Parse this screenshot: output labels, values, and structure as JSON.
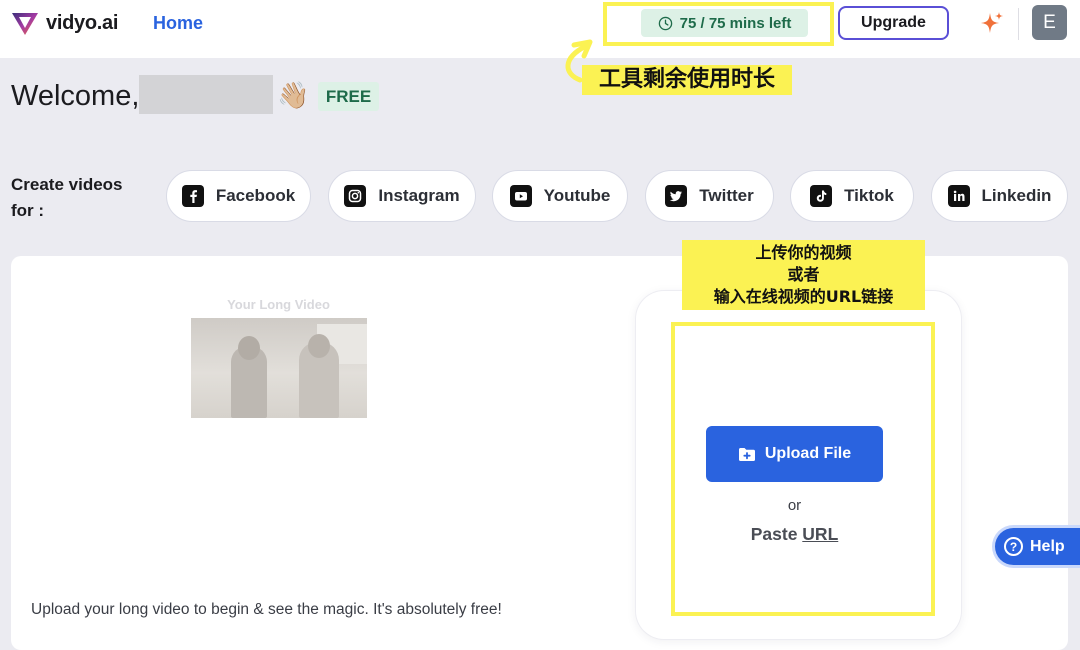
{
  "header": {
    "logo_text": "vidyo.ai",
    "nav_home": "Home",
    "credits": "75 / 75 mins left",
    "upgrade": "Upgrade",
    "avatar_initial": "E"
  },
  "annotations": {
    "credits_note": "工具剩余使用时长",
    "upload_note_line1": "上传你的视频",
    "upload_note_line2": "或者",
    "upload_note_line3": "输入在线视频的URL链接"
  },
  "welcome": {
    "greeting": "Welcome,",
    "emoji": "👋🏼",
    "plan_badge": "FREE"
  },
  "create": {
    "label_line1": "Create videos",
    "label_line2": "for :",
    "platforms": [
      {
        "label": "Facebook",
        "icon": "facebook-icon"
      },
      {
        "label": "Instagram",
        "icon": "instagram-icon"
      },
      {
        "label": "Youtube",
        "icon": "youtube-icon"
      },
      {
        "label": "Twitter",
        "icon": "twitter-icon"
      },
      {
        "label": "Tiktok",
        "icon": "tiktok-icon"
      },
      {
        "label": "Linkedin",
        "icon": "linkedin-icon"
      }
    ]
  },
  "main": {
    "preview_title": "Your Long Video",
    "caption": "Upload your long video to begin & see the magic. It's absolutely free!",
    "upload_button": "Upload File",
    "or_text": "or",
    "paste_prefix": "Paste ",
    "paste_link": "URL"
  },
  "help": {
    "label": "Help"
  },
  "colors": {
    "accent_blue": "#2a63df",
    "highlight_yellow": "#fbf253",
    "badge_green_bg": "#ddf1e6",
    "upgrade_border": "#5a4fd6"
  }
}
